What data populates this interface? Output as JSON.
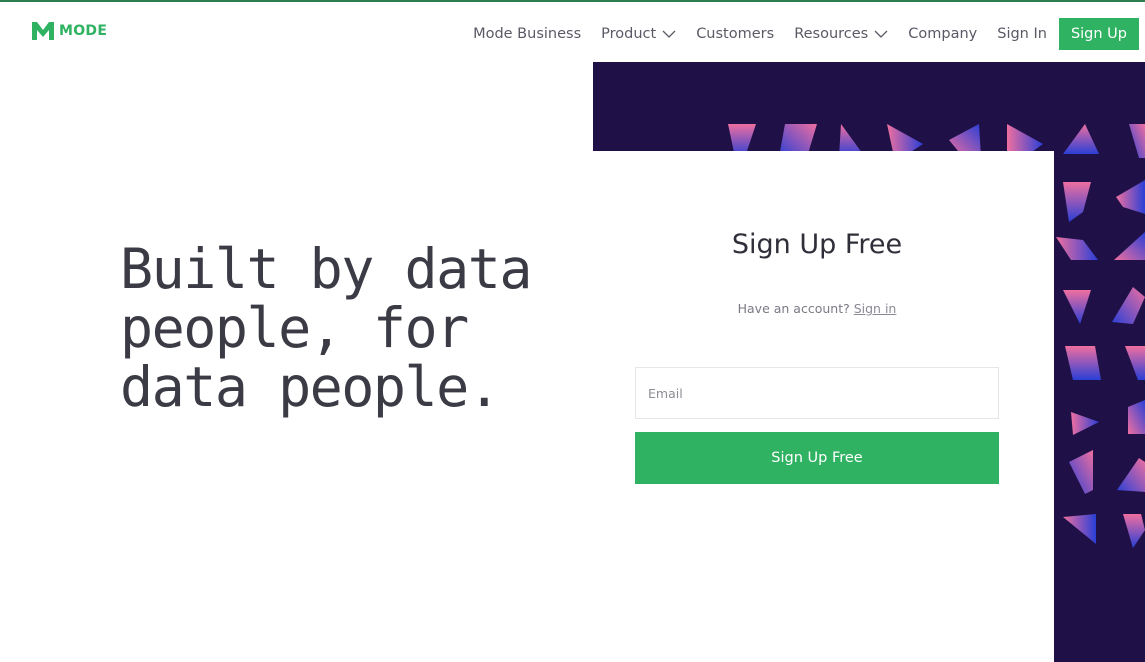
{
  "brand": {
    "name": "MODE",
    "color": "#2fb261"
  },
  "nav": {
    "items": [
      {
        "label": "Mode Business",
        "has_dropdown": false
      },
      {
        "label": "Product",
        "has_dropdown": true
      },
      {
        "label": "Customers",
        "has_dropdown": false
      },
      {
        "label": "Resources",
        "has_dropdown": true
      },
      {
        "label": "Company",
        "has_dropdown": false
      },
      {
        "label": "Sign In",
        "has_dropdown": false
      }
    ],
    "signup_label": "Sign Up"
  },
  "hero": {
    "lines": [
      "Built by data",
      "people, for",
      "data people."
    ]
  },
  "signup_card": {
    "title": "Sign Up Free",
    "have_account_text": "Have an account?",
    "sign_in_link": "Sign in",
    "email_placeholder": "Email",
    "email_value": "",
    "submit_label": "Sign Up Free"
  },
  "colors": {
    "accent": "#2fb261",
    "panel_background": "#1f1148",
    "text_dark": "#3b3b46",
    "shape_gradient_start": "#ef6fa0",
    "shape_gradient_end": "#2a3fd6"
  },
  "icons": {
    "logo": "mode-m-logo-icon",
    "dropdown": "chevron-down-icon"
  }
}
